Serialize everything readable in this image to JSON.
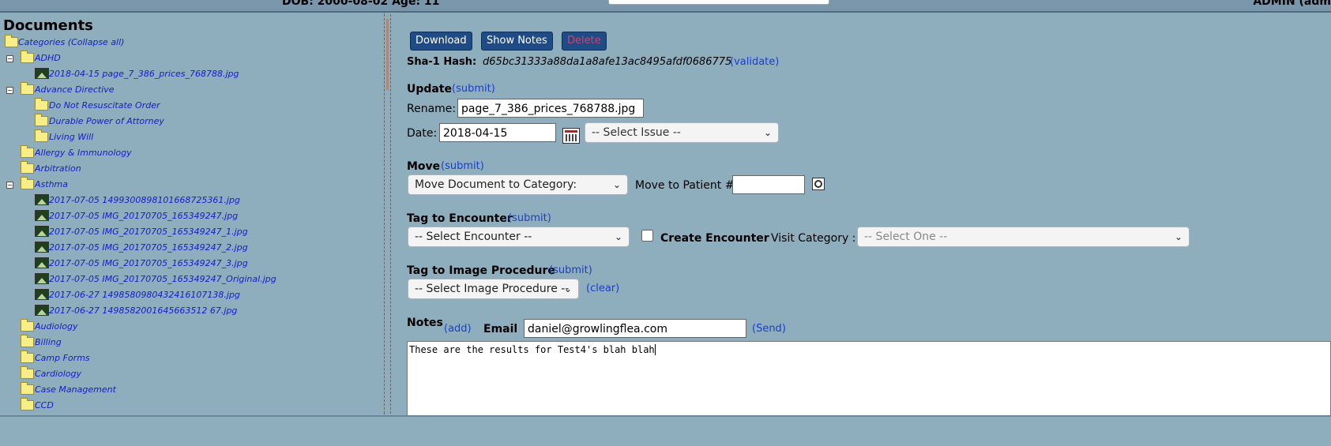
{
  "header": {
    "dob_text": "DOB: 2000-08-02 Age: 11",
    "user_text": "ADMIN (adm"
  },
  "sidebar": {
    "title": "Documents",
    "tree": [
      {
        "label": "Categories (Collapse all)",
        "type": "folder",
        "level": 0,
        "expand": ""
      },
      {
        "label": "ADHD",
        "type": "folder",
        "level": 1,
        "expand": "−"
      },
      {
        "label": "2018-04-15 page_7_386_prices_768788.jpg",
        "type": "image",
        "level": 2,
        "expand": ""
      },
      {
        "label": "Advance Directive",
        "type": "folder",
        "level": 1,
        "expand": "−"
      },
      {
        "label": "Do Not Resuscitate Order",
        "type": "folder",
        "level": 2,
        "expand": ""
      },
      {
        "label": "Durable Power of Attorney",
        "type": "folder",
        "level": 2,
        "expand": ""
      },
      {
        "label": "Living Will",
        "type": "folder",
        "level": 2,
        "expand": ""
      },
      {
        "label": "Allergy & Immunology",
        "type": "folder",
        "level": 1,
        "expand": ""
      },
      {
        "label": "Arbitration",
        "type": "folder",
        "level": 1,
        "expand": ""
      },
      {
        "label": "Asthma",
        "type": "folder",
        "level": 1,
        "expand": "−"
      },
      {
        "label": "2017-07-05 1499300898101668725361.jpg",
        "type": "image",
        "level": 2,
        "expand": ""
      },
      {
        "label": "2017-07-05 IMG_20170705_165349247.jpg",
        "type": "image",
        "level": 2,
        "expand": ""
      },
      {
        "label": "2017-07-05 IMG_20170705_165349247_1.jpg",
        "type": "image",
        "level": 2,
        "expand": ""
      },
      {
        "label": "2017-07-05 IMG_20170705_165349247_2.jpg",
        "type": "image",
        "level": 2,
        "expand": ""
      },
      {
        "label": "2017-07-05 IMG_20170705_165349247_3.jpg",
        "type": "image",
        "level": 2,
        "expand": ""
      },
      {
        "label": "2017-07-05 IMG_20170705_165349247_Original.jpg",
        "type": "image",
        "level": 2,
        "expand": ""
      },
      {
        "label": "2017-06-27 1498580980432416107138.jpg",
        "type": "image",
        "level": 2,
        "expand": ""
      },
      {
        "label": "2017-06-27 1498582001645663512 67.jpg",
        "type": "image",
        "level": 2,
        "expand": ""
      },
      {
        "label": "Audiology",
        "type": "folder",
        "level": 1,
        "expand": ""
      },
      {
        "label": "Billing",
        "type": "folder",
        "level": 1,
        "expand": ""
      },
      {
        "label": "Camp Forms",
        "type": "folder",
        "level": 1,
        "expand": ""
      },
      {
        "label": "Cardiology",
        "type": "folder",
        "level": 1,
        "expand": ""
      },
      {
        "label": "Case Management",
        "type": "folder",
        "level": 1,
        "expand": ""
      },
      {
        "label": "CCD",
        "type": "folder",
        "level": 1,
        "expand": ""
      }
    ]
  },
  "toolbar": {
    "download_label": "Download",
    "show_notes_label": "Show Notes",
    "delete_label": "Delete"
  },
  "hash": {
    "label": "Sha-1 Hash:",
    "value": "d65bc31333a88da1a8afe13ac8495afdf0686775",
    "validate_link": "(validate)"
  },
  "update": {
    "heading": "Update",
    "submit_link": "(submit)",
    "rename_label": "Rename:",
    "rename_value": "page_7_386_prices_768788.jpg",
    "date_label": "Date:",
    "date_value": "2018-04-15",
    "issue_select": "-- Select Issue --"
  },
  "move": {
    "heading": "Move",
    "submit_link": "(submit)",
    "category_select": "Move Document to Category:",
    "patient_label": "Move to Patient #",
    "patient_value": ""
  },
  "encounter": {
    "heading": "Tag to Encounter",
    "submit_link": "(submit)",
    "select": "-- Select Encounter --",
    "create_label": "Create Encounter",
    "visit_label": "Visit Category :",
    "visit_select": "-- Select One --"
  },
  "procedure": {
    "heading": "Tag to Image Procedure",
    "submit_link": "(submit)",
    "select": "-- Select Image Procedure --",
    "clear_link": "(clear)"
  },
  "notes": {
    "heading": "Notes",
    "add_link": "(add)",
    "email_label": "Email",
    "email_value": "daniel@growlingflea.com",
    "send_link": "(Send)",
    "text": "These are the results for Test4's blah blah"
  }
}
